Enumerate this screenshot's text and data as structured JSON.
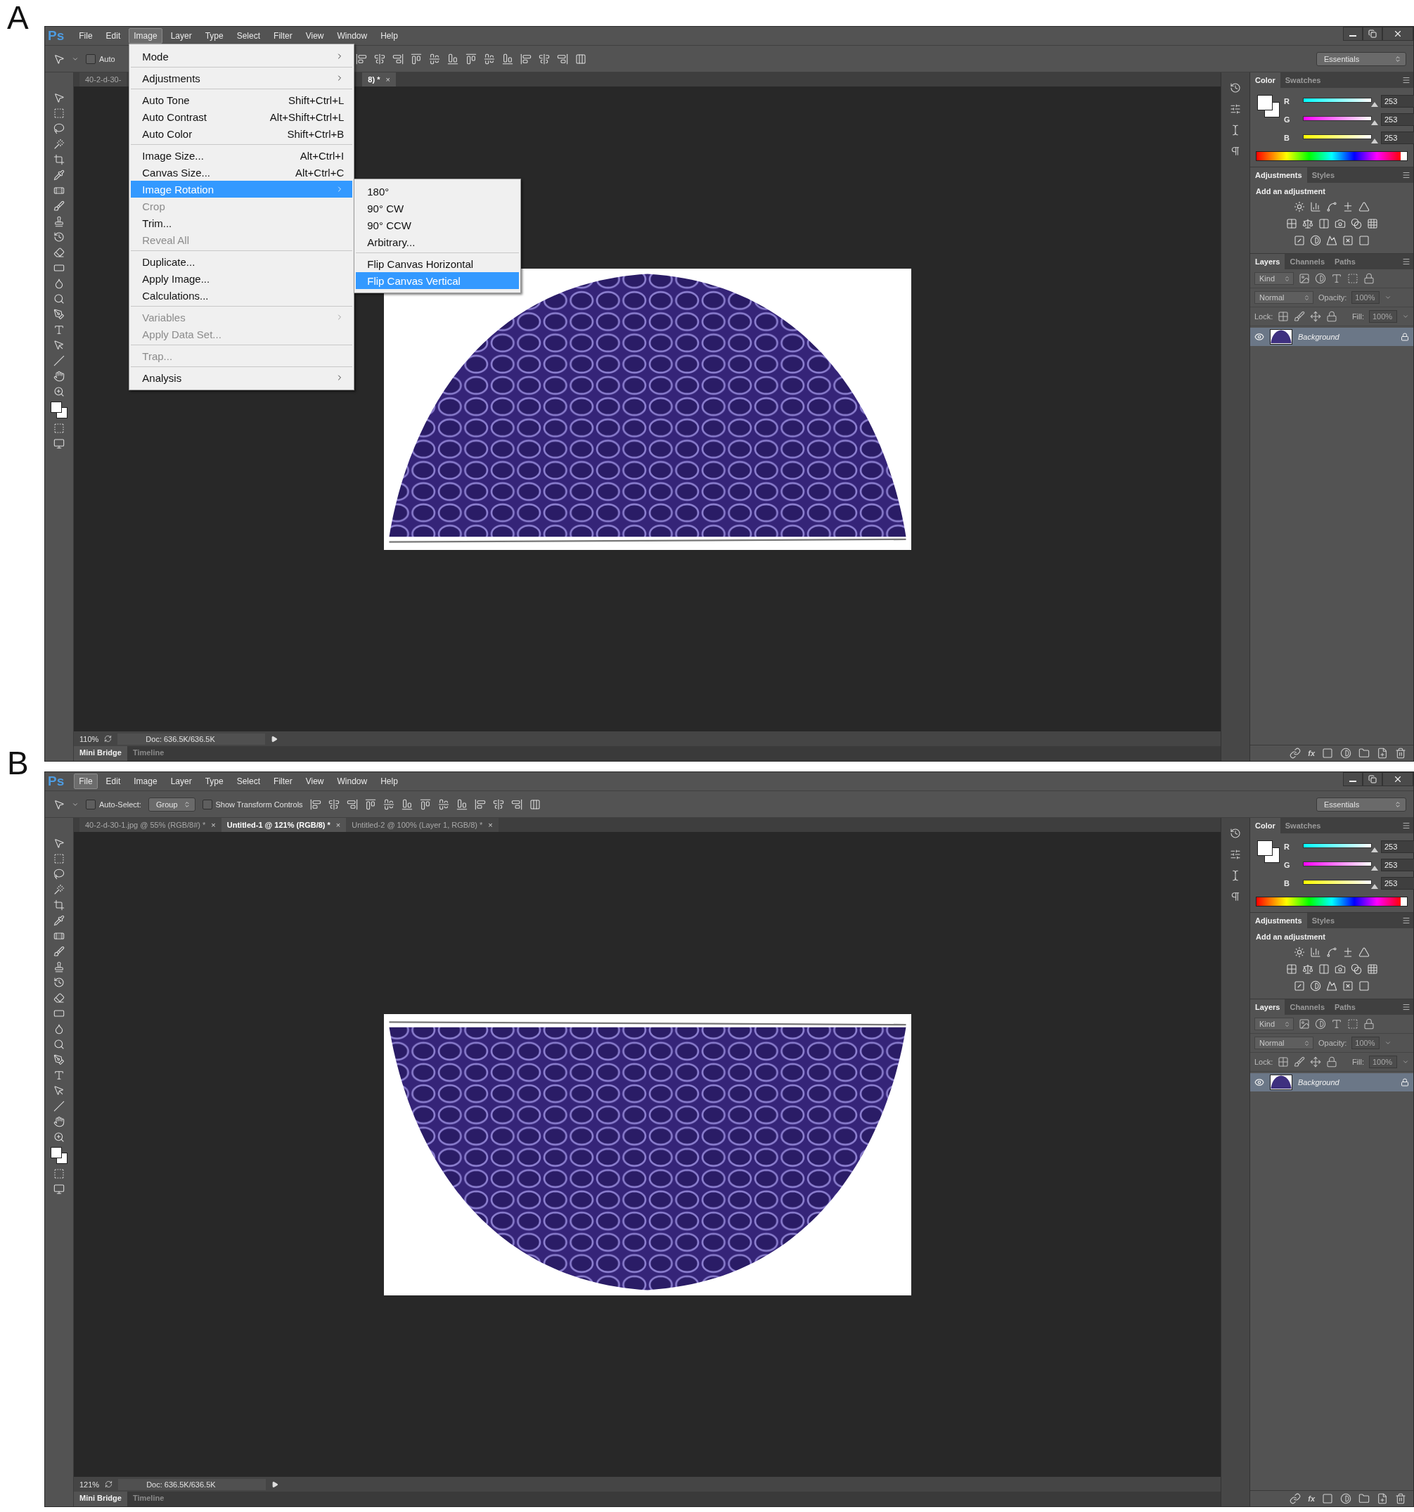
{
  "panels": [
    {
      "label": "A",
      "menu_bar": {
        "logo": "Ps",
        "items": [
          {
            "label": "File",
            "selected": false
          },
          {
            "label": "Edit",
            "selected": false
          },
          {
            "label": "Image",
            "selected": true
          },
          {
            "label": "Layer",
            "selected": false
          },
          {
            "label": "Type",
            "selected": false
          },
          {
            "label": "Select",
            "selected": false
          },
          {
            "label": "Filter",
            "selected": false
          },
          {
            "label": "View",
            "selected": false
          },
          {
            "label": "Window",
            "selected": false
          },
          {
            "label": "Help",
            "selected": false
          }
        ]
      },
      "options_bar": {
        "items": [
          {
            "kind": "checkbox",
            "label": "Auto",
            "checked": false
          }
        ],
        "workspace": "Essentials"
      },
      "tabs": [
        {
          "label": "40-2-d-30-",
          "selected": false
        },
        {
          "label": "8) *",
          "selected": true,
          "close": "×"
        }
      ],
      "menu": {
        "groups": [
          {
            "items": [
              {
                "label": "Mode",
                "submenu": true,
                "disabled": false,
                "selected": false
              }
            ]
          },
          {
            "items": [
              {
                "label": "Adjustments",
                "submenu": true,
                "disabled": false,
                "selected": false
              }
            ]
          },
          {
            "items": [
              {
                "label": "Auto Tone",
                "shortcut": "Shift+Ctrl+L",
                "disabled": false,
                "selected": false
              },
              {
                "label": "Auto Contrast",
                "shortcut": "Alt+Shift+Ctrl+L",
                "disabled": false,
                "selected": false
              },
              {
                "label": "Auto Color",
                "shortcut": "Shift+Ctrl+B",
                "disabled": false,
                "selected": false
              }
            ]
          },
          {
            "items": [
              {
                "label": "Image Size...",
                "shortcut": "Alt+Ctrl+I",
                "disabled": false,
                "selected": false
              },
              {
                "label": "Canvas Size...",
                "shortcut": "Alt+Ctrl+C",
                "disabled": false,
                "selected": false
              },
              {
                "label": "Image Rotation",
                "submenu": true,
                "disabled": false,
                "selected": true
              },
              {
                "label": "Crop",
                "disabled": true,
                "selected": false
              },
              {
                "label": "Trim...",
                "disabled": false,
                "selected": false
              },
              {
                "label": "Reveal All",
                "disabled": true,
                "selected": false
              }
            ]
          },
          {
            "items": [
              {
                "label": "Duplicate...",
                "disabled": false,
                "selected": false
              },
              {
                "label": "Apply Image...",
                "disabled": false,
                "selected": false
              },
              {
                "label": "Calculations...",
                "disabled": false,
                "selected": false
              }
            ]
          },
          {
            "items": [
              {
                "label": "Variables",
                "submenu": true,
                "disabled": true,
                "selected": false
              },
              {
                "label": "Apply Data Set...",
                "disabled": true,
                "selected": false
              }
            ]
          },
          {
            "items": [
              {
                "label": "Trap...",
                "disabled": true,
                "selected": false
              }
            ]
          },
          {
            "items": [
              {
                "label": "Analysis",
                "submenu": true,
                "disabled": false,
                "selected": false
              }
            ]
          }
        ]
      },
      "submenu": {
        "groups": [
          {
            "items": [
              {
                "label": "180°",
                "selected": false
              },
              {
                "label": "90° CW",
                "selected": false
              },
              {
                "label": "90° CCW",
                "selected": false
              },
              {
                "label": "Arbitrary...",
                "selected": false
              }
            ]
          },
          {
            "items": [
              {
                "label": "Flip Canvas Horizontal",
                "selected": false
              },
              {
                "label": "Flip Canvas Vertical",
                "selected": true
              }
            ]
          }
        ]
      },
      "document": {
        "flipped": false
      },
      "status_bar": {
        "zoom": "110%",
        "doc": "Doc: 636.5K/636.5K"
      },
      "bottom_tabs": [
        {
          "label": "Mini Bridge",
          "selected": true
        },
        {
          "label": "Timeline",
          "selected": false
        }
      ],
      "color_panel": {
        "tabs": [
          {
            "label": "Color",
            "selected": true
          },
          {
            "label": "Swatches",
            "selected": false
          }
        ],
        "channels": [
          {
            "name": "R",
            "value": "253",
            "level": 0.99
          },
          {
            "name": "G",
            "value": "253",
            "level": 0.99
          },
          {
            "name": "B",
            "value": "253",
            "level": 0.99
          }
        ]
      },
      "adjustments_panel": {
        "tabs": [
          {
            "label": "Adjustments",
            "selected": true
          },
          {
            "label": "Styles",
            "selected": false
          }
        ],
        "heading": "Add an adjustment"
      },
      "layers_panel": {
        "tabs": [
          {
            "label": "Layers",
            "selected": true
          },
          {
            "label": "Channels",
            "selected": false
          },
          {
            "label": "Paths",
            "selected": false
          }
        ],
        "filter": "Kind",
        "blend_mode": "Normal",
        "opacity": {
          "label": "Opacity:",
          "value": "100%",
          "disabled": true
        },
        "lock_label": "Lock:",
        "fill": {
          "label": "Fill:",
          "value": "100%",
          "disabled": true
        },
        "layers": [
          {
            "name": "Background",
            "selected": true,
            "visible": true,
            "locked": true
          }
        ],
        "footer_fx": "fx"
      }
    },
    {
      "label": "B",
      "menu_bar": {
        "logo": "Ps",
        "items": [
          {
            "label": "File",
            "selected": true
          },
          {
            "label": "Edit",
            "selected": false
          },
          {
            "label": "Image",
            "selected": false
          },
          {
            "label": "Layer",
            "selected": false
          },
          {
            "label": "Type",
            "selected": false
          },
          {
            "label": "Select",
            "selected": false
          },
          {
            "label": "Filter",
            "selected": false
          },
          {
            "label": "View",
            "selected": false
          },
          {
            "label": "Window",
            "selected": false
          },
          {
            "label": "Help",
            "selected": false
          }
        ]
      },
      "options_bar": {
        "items": [
          {
            "kind": "checkbox",
            "label": "Auto-Select:",
            "checked": false
          },
          {
            "kind": "select",
            "label": "Group"
          },
          {
            "kind": "checkbox",
            "label": "Show Transform Controls",
            "checked": false
          }
        ],
        "workspace": "Essentials"
      },
      "tabs": [
        {
          "label": "40-2-d-30-1.jpg @ 55% (RGB/8#) *",
          "selected": false,
          "close": "×"
        },
        {
          "label": "Untitled-1 @ 121% (RGB/8) *",
          "selected": true,
          "close": "×"
        },
        {
          "label": "Untitled-2 @ 100% (Layer 1, RGB/8) *",
          "selected": false,
          "close": "×"
        }
      ],
      "document": {
        "flipped": true
      },
      "status_bar": {
        "zoom": "121%",
        "doc": "Doc: 636.5K/636.5K"
      },
      "bottom_tabs": [
        {
          "label": "Mini Bridge",
          "selected": true
        },
        {
          "label": "Timeline",
          "selected": false
        }
      ],
      "color_panel": {
        "tabs": [
          {
            "label": "Color",
            "selected": true
          },
          {
            "label": "Swatches",
            "selected": false
          }
        ],
        "channels": [
          {
            "name": "R",
            "value": "253",
            "level": 0.99
          },
          {
            "name": "G",
            "value": "253",
            "level": 0.99
          },
          {
            "name": "B",
            "value": "253",
            "level": 0.99
          }
        ]
      },
      "adjustments_panel": {
        "tabs": [
          {
            "label": "Adjustments",
            "selected": true
          },
          {
            "label": "Styles",
            "selected": false
          }
        ],
        "heading": "Add an adjustment"
      },
      "layers_panel": {
        "tabs": [
          {
            "label": "Layers",
            "selected": true
          },
          {
            "label": "Channels",
            "selected": false
          },
          {
            "label": "Paths",
            "selected": false
          }
        ],
        "filter": "Kind",
        "blend_mode": "Normal",
        "opacity": {
          "label": "Opacity:",
          "value": "100%",
          "disabled": true
        },
        "lock_label": "Lock:",
        "fill": {
          "label": "Fill:",
          "value": "100%",
          "disabled": true
        },
        "layers": [
          {
            "name": "Background",
            "selected": true,
            "visible": true,
            "locked": true
          }
        ],
        "footer_fx": "fx"
      }
    }
  ]
}
